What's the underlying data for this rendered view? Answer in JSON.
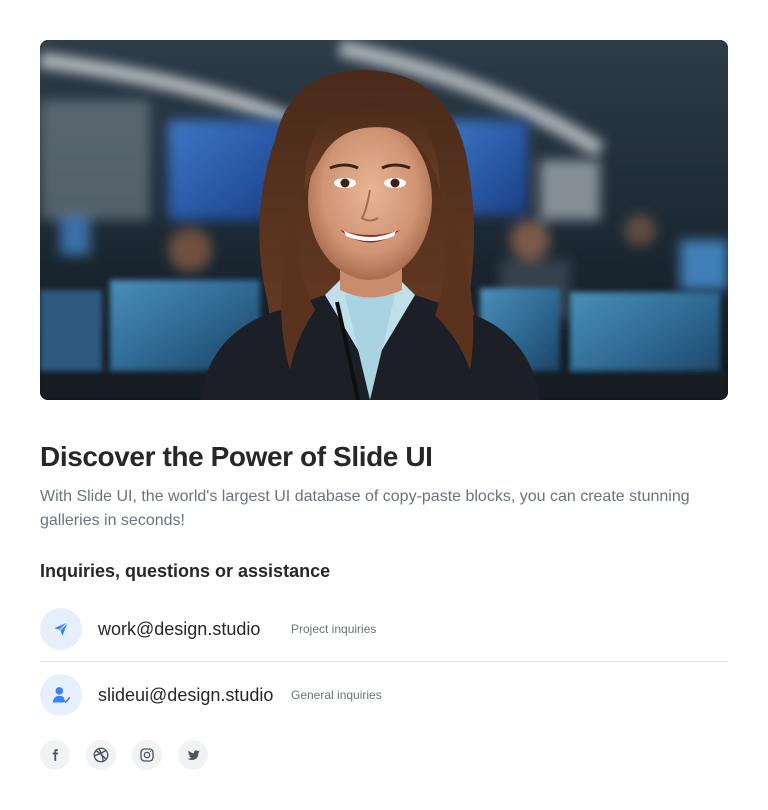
{
  "hero": {
    "image": "portrait-photo-businesswoman-office"
  },
  "title": "Discover the Power of Slide UI",
  "description": "With Slide UI, the world's largest UI database of copy-paste blocks, you can create stunning galleries in seconds!",
  "contact": {
    "heading": "Inquiries, questions or assistance",
    "items": [
      {
        "icon": "send-icon",
        "email": "work@design.studio",
        "label": "Project inquiries"
      },
      {
        "icon": "user-check-icon",
        "email": "slideui@design.studio",
        "label": "General inquiries"
      }
    ]
  },
  "socials": [
    "facebook-icon",
    "dribbble-icon",
    "instagram-icon",
    "twitter-icon"
  ],
  "colors": {
    "accent": "#3b82f6",
    "icon_bg": "#e6f0fc",
    "title": "#27272a",
    "muted": "#6b7280",
    "divider": "#e5e7eb"
  }
}
